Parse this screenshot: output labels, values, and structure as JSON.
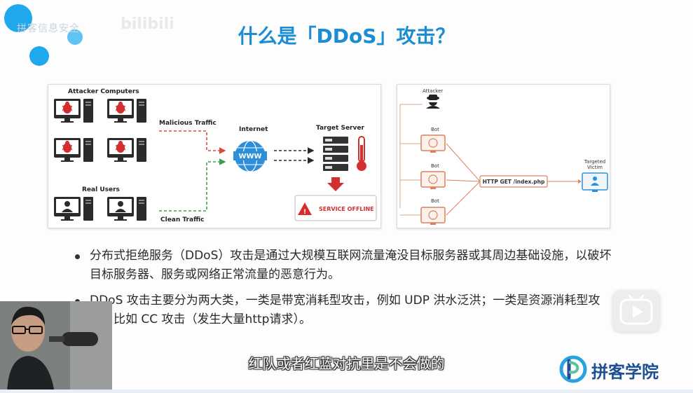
{
  "watermark": {
    "text": "拼客信息安全",
    "brand": "bilibili"
  },
  "slide": {
    "title": "什么是「DDoS」攻击？"
  },
  "diagram_left": {
    "attacker_label": "Attacker Computers",
    "malicious_label": "Malicious Traffic",
    "internet_label": "Internet",
    "www_label": "WWW",
    "server_label": "Target Server",
    "users_label": "Real Users",
    "clean_label": "Clean Traffic",
    "offline_label": "SERVICE OFFLINE"
  },
  "diagram_right": {
    "attacker_label": "Attacker",
    "bot_labels": [
      "Bot",
      "Bot",
      "Bot"
    ],
    "request_label": "HTTP GET /index.php",
    "victim_label_1": "Targeted",
    "victim_label_2": "Victim"
  },
  "bullets": [
    "分布式拒绝服务（DDoS）攻击是通过大规模互联网流量淹没目标服务器或其周边基础设施，以破坏目标服务器、服务或网络正常流量的恶意行为。",
    "DDoS 攻击主要分为两大类，一类是带宽消耗型攻击，例如 UDP 洪水泛洪；一类是资源消耗型攻击，比如 CC 攻击（发生大量http请求）。"
  ],
  "subtitle": "红队或者红蓝对抗里是不会做的",
  "logo": {
    "text": "拼客学院"
  },
  "colors": {
    "title": "#1c8dd3",
    "danger": "#d42e2e",
    "malicious": "#d94a3d",
    "clean": "#3aa14a",
    "accent_blue": "#2d8fd8"
  }
}
